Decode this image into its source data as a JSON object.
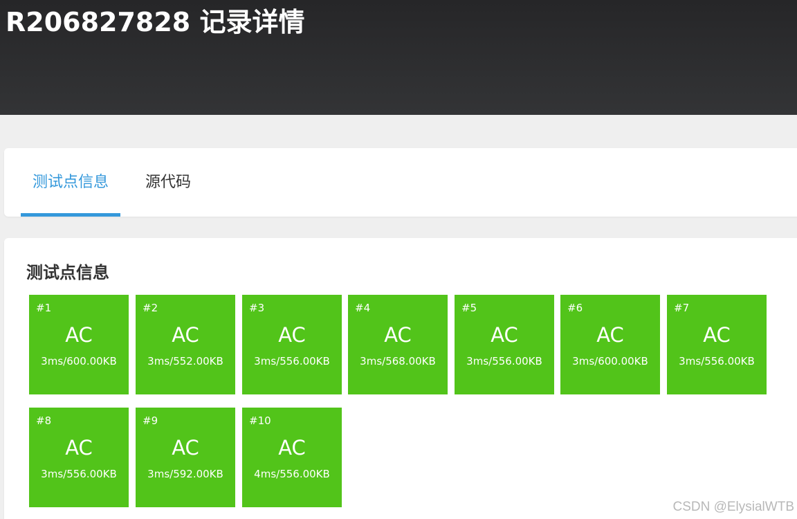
{
  "header": {
    "title": "R206827828 记录详情"
  },
  "tabs": [
    {
      "label": "测试点信息",
      "active": true
    },
    {
      "label": "源代码",
      "active": false
    }
  ],
  "section": {
    "title": "测试点信息"
  },
  "status_color": "#52c41a",
  "accent_color": "#3498db",
  "testcases": [
    {
      "id": "#1",
      "status": "AC",
      "info": "3ms/600.00KB"
    },
    {
      "id": "#2",
      "status": "AC",
      "info": "3ms/552.00KB"
    },
    {
      "id": "#3",
      "status": "AC",
      "info": "3ms/556.00KB"
    },
    {
      "id": "#4",
      "status": "AC",
      "info": "3ms/568.00KB"
    },
    {
      "id": "#5",
      "status": "AC",
      "info": "3ms/556.00KB"
    },
    {
      "id": "#6",
      "status": "AC",
      "info": "3ms/600.00KB"
    },
    {
      "id": "#7",
      "status": "AC",
      "info": "3ms/556.00KB"
    },
    {
      "id": "#8",
      "status": "AC",
      "info": "3ms/556.00KB"
    },
    {
      "id": "#9",
      "status": "AC",
      "info": "3ms/592.00KB"
    },
    {
      "id": "#10",
      "status": "AC",
      "info": "4ms/556.00KB"
    }
  ],
  "watermark": "CSDN @ElysialWTB"
}
